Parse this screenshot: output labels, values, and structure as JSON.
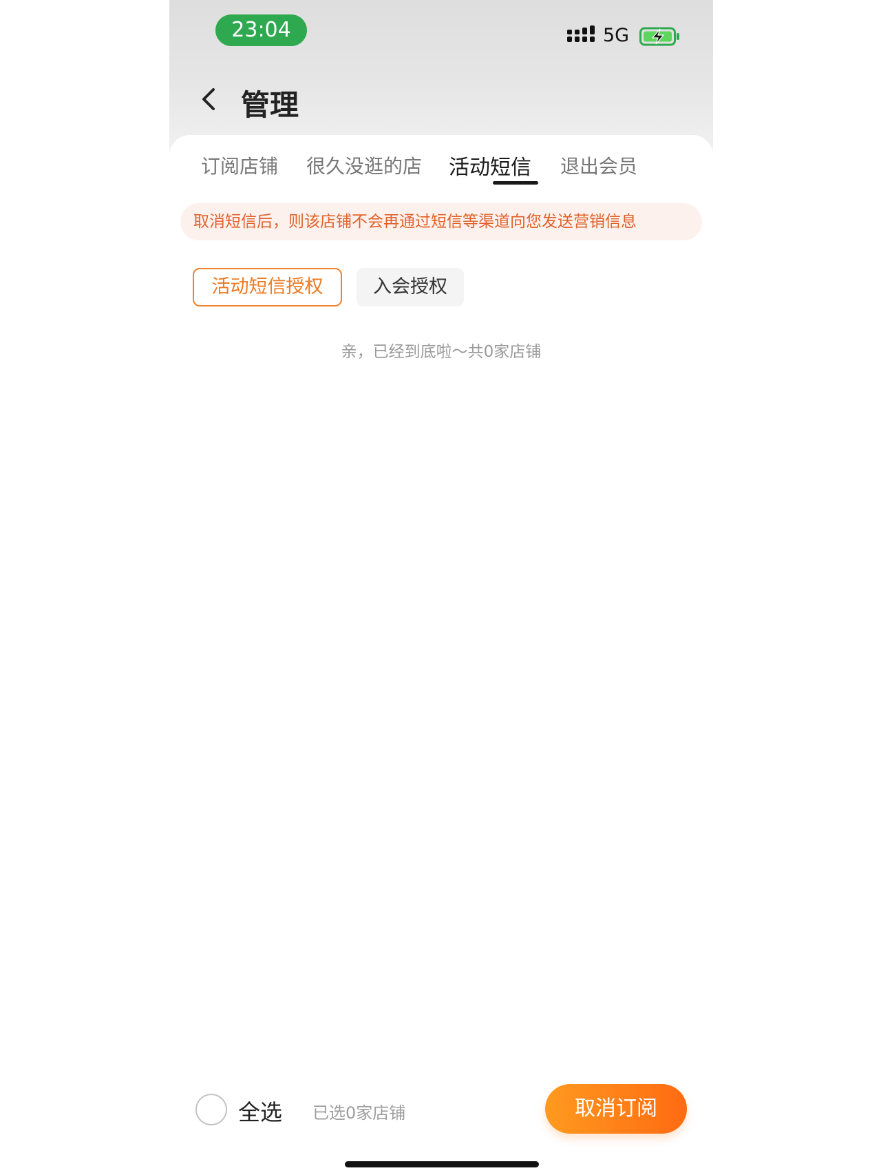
{
  "status_bar": {
    "time": "23:04",
    "network": "5G",
    "signal_icon": "signal-bars-icon",
    "battery_icon": "battery-charging-icon",
    "time_pill_color": "#2fa94f"
  },
  "header": {
    "back_icon": "chevron-left-icon",
    "title": "管理"
  },
  "tabs": [
    {
      "label": "订阅店铺",
      "active": false
    },
    {
      "label": "很久没逛的店",
      "active": false
    },
    {
      "label": "活动短信",
      "active": true
    },
    {
      "label": "退出会员",
      "active": false
    }
  ],
  "notice": {
    "text": "取消短信后，则该店铺不会再通过短信等渠道向您发送营销信息",
    "color": "#e0622a"
  },
  "filter_chips": [
    {
      "label": "活动短信授权",
      "selected": true
    },
    {
      "label": "入会授权",
      "selected": false
    }
  ],
  "end_note": "亲，已经到底啦～共0家店铺",
  "footer": {
    "select_all_label": "全选",
    "selected_count_text": "已选0家店铺",
    "action_label": "取消订阅",
    "accent_color": "#ff7a18"
  }
}
